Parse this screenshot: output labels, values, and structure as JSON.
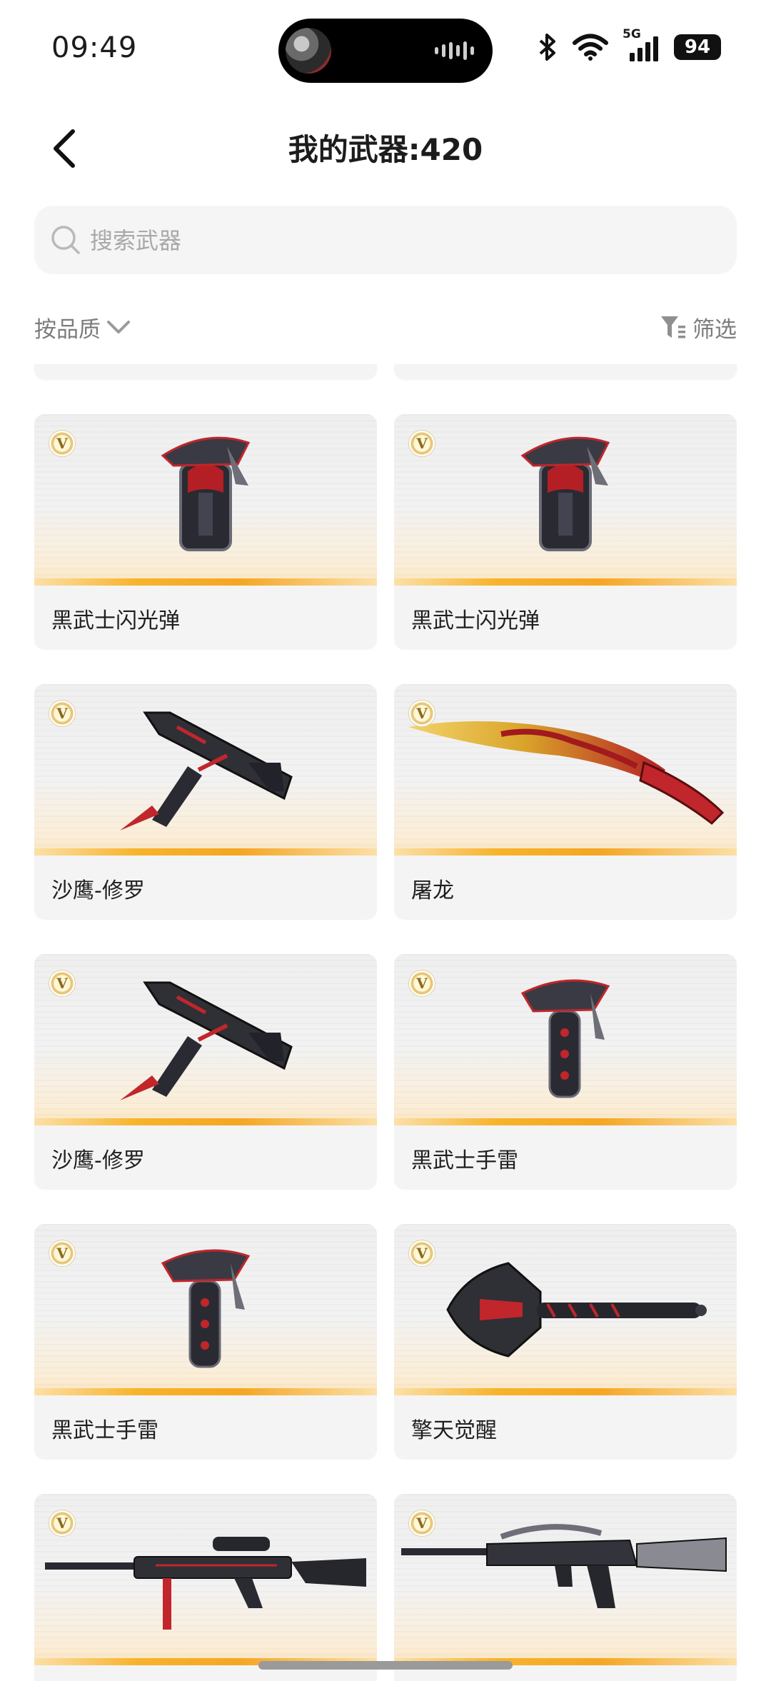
{
  "status_bar": {
    "time": "09:49",
    "battery": "94",
    "network": "5G"
  },
  "header": {
    "title": "我的武器:420"
  },
  "search": {
    "placeholder": "搜索武器"
  },
  "filters": {
    "sort_label": "按品质",
    "filter_label": "筛选"
  },
  "badge_text": "V",
  "weapons": [
    {
      "name": "黑武士闪光弹",
      "icon": "flashbang-icon"
    },
    {
      "name": "黑武士闪光弹",
      "icon": "flashbang-icon"
    },
    {
      "name": "沙鹰-修罗",
      "icon": "desert-eagle-icon"
    },
    {
      "name": "屠龙",
      "icon": "dragon-blade-icon"
    },
    {
      "name": "沙鹰-修罗",
      "icon": "desert-eagle-icon"
    },
    {
      "name": "黑武士手雷",
      "icon": "grenade-icon"
    },
    {
      "name": "黑武士手雷",
      "icon": "grenade-icon"
    },
    {
      "name": "擎天觉醒",
      "icon": "axe-icon"
    },
    {
      "name": "",
      "icon": "sniper-rifle-icon"
    },
    {
      "name": "",
      "icon": "assault-rifle-icon"
    }
  ],
  "colors": {
    "accent": "#f5a623",
    "card_bg": "#f4f4f4",
    "weapon_red": "#c0262b",
    "weapon_dark": "#2a2a33"
  }
}
